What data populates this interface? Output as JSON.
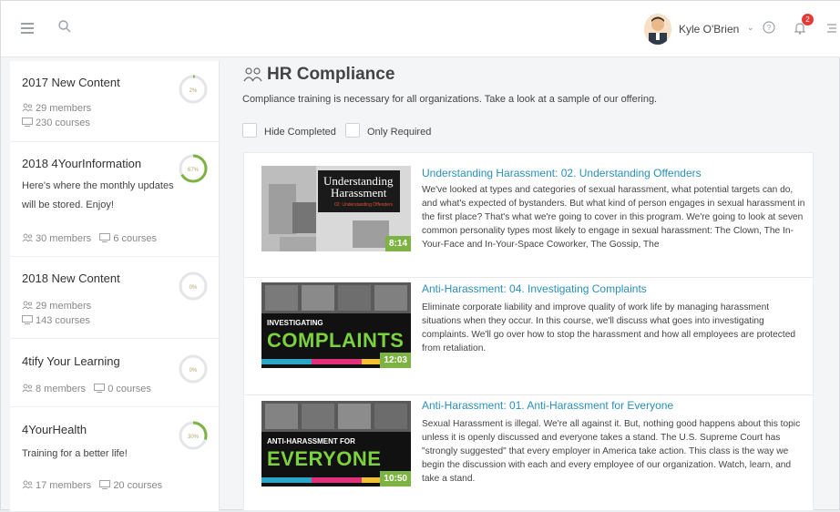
{
  "header": {
    "user_name": "Kyle O'Brien",
    "notification_count": "2"
  },
  "sidebar": {
    "groups": [
      {
        "title": "2017 New Content",
        "progress": "2%",
        "progress_value": 2,
        "members": "29 members",
        "courses": "230 courses"
      },
      {
        "title": "2018 4YourInformation",
        "progress": "67%",
        "progress_value": 67,
        "description": "Here's where the monthly updates will be stored. Enjoy!",
        "members": "30 members",
        "courses": "6 courses"
      },
      {
        "title": "2018 New Content",
        "progress": "0%",
        "progress_value": 0,
        "members": "29 members",
        "courses": "143 courses"
      },
      {
        "title": "4tify Your Learning",
        "progress": "0%",
        "progress_value": 0,
        "members": "8 members",
        "courses": "0 courses"
      },
      {
        "title": "4YourHealth",
        "progress": "30%",
        "progress_value": 30,
        "description": "Training for a better life!",
        "members": "17 members",
        "courses": "20 courses"
      }
    ]
  },
  "main": {
    "title": "HR Compliance",
    "description": "Compliance training is necessary for all organizations. Take a look at a sample of our offering.",
    "filters": {
      "hide_completed": "Hide Completed",
      "only_required": "Only Required"
    },
    "courses": [
      {
        "title": "Understanding Harassment: 02. Understanding Offenders",
        "description": "We've looked at types and categories of sexual harassment, what potential targets can do, and what's expected of bystanders. But what kind of person engages in sexual harassment in the first place? That's what we're going to cover in this program. We're going to look at seven common personality types most likely to engage in sexual harassment: The Clown, The In-Your-Face and In-Your-Space Coworker, The Gossip, The",
        "duration": "8:14",
        "thumb_line1": "Understanding",
        "thumb_line2": "Harassment",
        "thumb_sub": "02: Understanding Offenders"
      },
      {
        "title": "Anti-Harassment: 04. Investigating Complaints",
        "description": "Eliminate corporate liability and improve quality of work life by managing harassment situations when they occur. In this course, we'll discuss what goes into investigating complaints. We'll go over how to stop the harassment and how all employees are protected from retaliation.",
        "duration": "12:03",
        "thumb_small": "INVESTIGATING",
        "thumb_big": "COMPLAINTS"
      },
      {
        "title": "Anti-Harassment: 01. Anti-Harassment for Everyone",
        "description": "Sexual Harassment is illegal. We're all against it. But, nothing good happens about this topic unless it is openly discussed and everyone takes a stand. The U.S. Supreme Court has \"strongly suggested\" that every employer in America take action. This class is the way we begin the discussion with each and every employee of our organization. Watch, learn, and take a stand.",
        "duration": "10:50",
        "thumb_small": "ANTI-HARASSMENT FOR",
        "thumb_big": "EVERYONE"
      }
    ]
  },
  "colors": {
    "accent_link": "#2a8fbd",
    "progress_green": "#7cb342",
    "thumb_big_text": "#7cd13f",
    "badge_red": "#e53935"
  }
}
